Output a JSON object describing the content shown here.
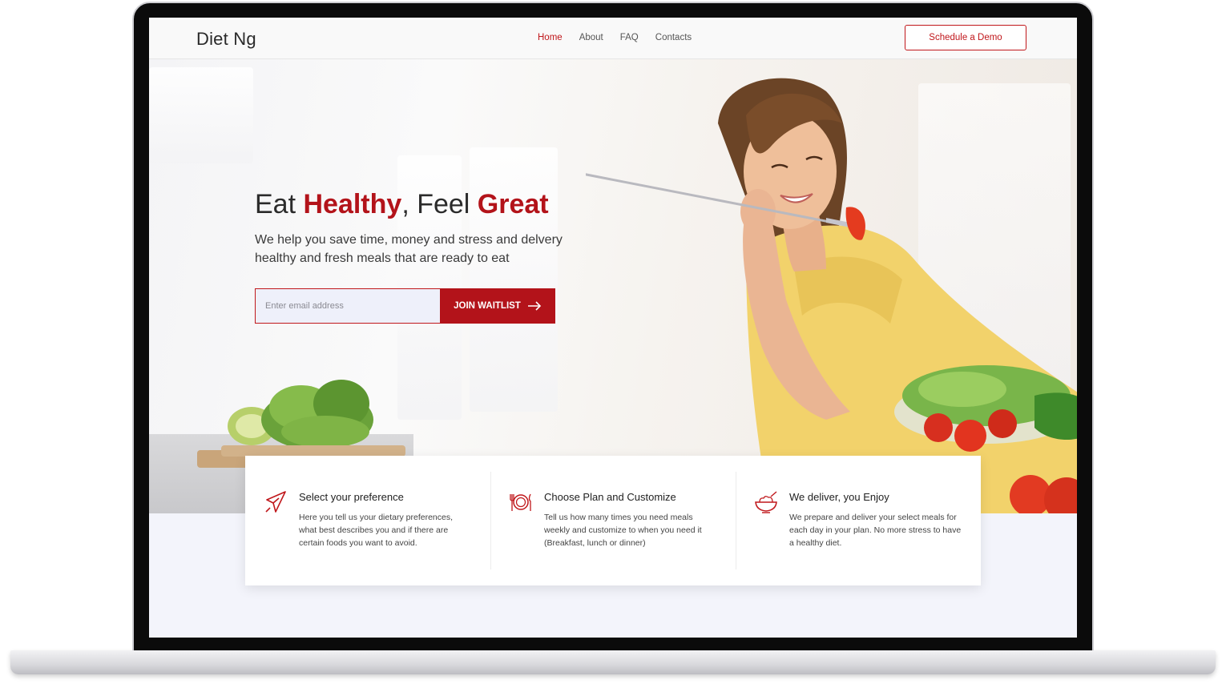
{
  "brand": {
    "name": "Diet Ng",
    "accent_color": "#b3131a"
  },
  "nav": {
    "items": [
      {
        "label": "Home",
        "active": true
      },
      {
        "label": "About",
        "active": false
      },
      {
        "label": "FAQ",
        "active": false
      },
      {
        "label": "Contacts",
        "active": false
      }
    ],
    "cta_label": "Schedule a Demo"
  },
  "hero": {
    "headline_part1": "Eat ",
    "headline_highlight1": "Healthy",
    "headline_part2": ", Feel ",
    "headline_highlight2": "Great",
    "subtitle": "We help you save time, money and stress and delvery healthy and fresh meals that are ready to eat",
    "email_placeholder": "Enter email address",
    "join_label": "JOIN WAITLIST",
    "join_icon": "arrow-right-icon"
  },
  "features": [
    {
      "icon": "pointer-icon",
      "title": "Select your preference",
      "description": "Here you tell us your dietary preferences, what best describes you and if there are certain foods you want to avoid."
    },
    {
      "icon": "plate-cutlery-icon",
      "title": "Choose Plan and Customize",
      "description": "Tell us how many times you need meals weekly and customize to when you need it (Breakfast, lunch or dinner)"
    },
    {
      "icon": "salad-bowl-icon",
      "title": "We deliver, you Enjoy",
      "description": "We prepare and deliver your select meals for each day in your plan. No more stress to have a healthy diet."
    }
  ]
}
